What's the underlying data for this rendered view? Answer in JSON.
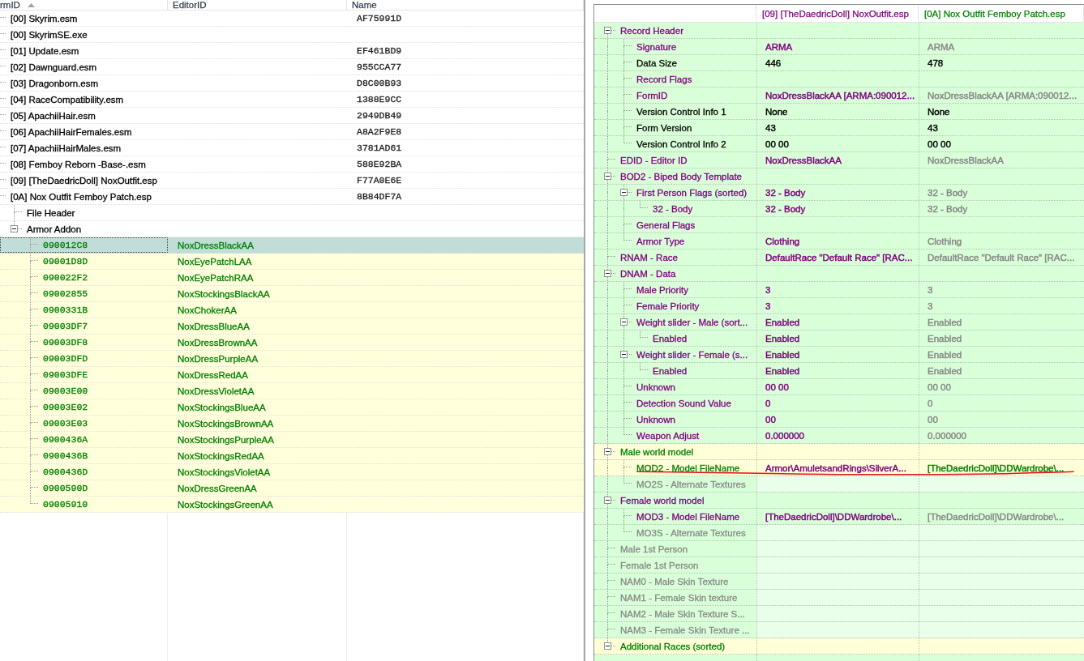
{
  "left_pane": {
    "columns": [
      {
        "label": "rmID",
        "sorted": true
      },
      {
        "label": "EditorID"
      },
      {
        "label": "Name"
      }
    ],
    "tree": [
      {
        "kind": "plugin",
        "label": "[00] Skyrim.esm",
        "name": "AF75991D",
        "selected": false,
        "highlighted": false
      },
      {
        "kind": "plugin",
        "label": "[00] SkyrimSE.exe",
        "selected": false,
        "highlighted": false
      },
      {
        "kind": "plugin",
        "label": "[01] Update.esm",
        "name": "EF461BD9",
        "selected": false,
        "highlighted": false
      },
      {
        "kind": "plugin",
        "label": "[02] Dawnguard.esm",
        "name": "955CCA77",
        "selected": false,
        "highlighted": false
      },
      {
        "kind": "plugin",
        "label": "[03] Dragonborn.esm",
        "name": "D8C00B93",
        "selected": false,
        "highlighted": false
      },
      {
        "kind": "plugin",
        "label": "[04] RaceCompatibility.esm",
        "name": "1388E9CC",
        "selected": false,
        "highlighted": false
      },
      {
        "kind": "plugin",
        "label": "[05] ApachiiHair.esm",
        "name": "2949DB49",
        "selected": false,
        "highlighted": false
      },
      {
        "kind": "plugin",
        "label": "[06] ApachiiHairFemales.esm",
        "name": "A8A2F9E8",
        "selected": false,
        "highlighted": false
      },
      {
        "kind": "plugin",
        "label": "[07] ApachiiHairMales.esm",
        "name": "3781AD61",
        "selected": false,
        "highlighted": false
      },
      {
        "kind": "plugin",
        "label": "[08] Femboy Reborn -Base-.esm",
        "name": "588E92BA",
        "selected": false,
        "highlighted": false
      },
      {
        "kind": "plugin",
        "label": "[09] [TheDaedricDoll] NoxOutfit.esp",
        "name": "F77A0E6E",
        "selected": false,
        "highlighted": false
      },
      {
        "kind": "plugin",
        "label": "[0A] Nox Outfit Femboy Patch.esp",
        "name": "8B84DF7A",
        "selected": false,
        "highlighted": false,
        "children": [
          {
            "kind": "group",
            "label": "File Header",
            "selected": false,
            "highlighted": false
          },
          {
            "kind": "group",
            "label": "Armor Addon",
            "selected": false,
            "highlighted": false,
            "expanded": true,
            "children": [
              {
                "kind": "record",
                "label": "090012C8",
                "editor_id": "NoxDressBlackAA",
                "color": "#008000",
                "selected": true
              },
              {
                "kind": "record",
                "label": "09001D8D",
                "editor_id": "NoxEyePatchLAA",
                "color": "#008000",
                "selected": false,
                "highlighted": true
              },
              {
                "kind": "record",
                "label": "090022F2",
                "editor_id": "NoxEyePatchRAA",
                "color": "#008000",
                "selected": false,
                "highlighted": true
              },
              {
                "kind": "record",
                "label": "09002855",
                "editor_id": "NoxStockingsBlackAA",
                "color": "#008000",
                "selected": false,
                "highlighted": true
              },
              {
                "kind": "record",
                "label": "0900331B",
                "editor_id": "NoxChokerAA",
                "color": "#008000",
                "selected": false,
                "highlighted": true
              },
              {
                "kind": "record",
                "label": "09003DF7",
                "editor_id": "NoxDressBlueAA",
                "color": "#008000",
                "selected": false,
                "highlighted": true
              },
              {
                "kind": "record",
                "label": "09003DF8",
                "editor_id": "NoxDressBrownAA",
                "color": "#008000",
                "selected": false,
                "highlighted": true
              },
              {
                "kind": "record",
                "label": "09003DFD",
                "editor_id": "NoxDressPurpleAA",
                "color": "#008000",
                "selected": false,
                "highlighted": true
              },
              {
                "kind": "record",
                "label": "09003DFE",
                "editor_id": "NoxDressRedAA",
                "color": "#008000",
                "selected": false,
                "highlighted": true
              },
              {
                "kind": "record",
                "label": "09003E00",
                "editor_id": "NoxDressVioletAA",
                "color": "#008000",
                "selected": false,
                "highlighted": true
              },
              {
                "kind": "record",
                "label": "09003E02",
                "editor_id": "NoxStockingsBlueAA",
                "color": "#008000",
                "selected": false,
                "highlighted": true
              },
              {
                "kind": "record",
                "label": "09003E03",
                "editor_id": "NoxStockingsBrownAA",
                "color": "#008000",
                "selected": false,
                "highlighted": true
              },
              {
                "kind": "record",
                "label": "0900436A",
                "editor_id": "NoxStockingsPurpleAA",
                "color": "#008000",
                "selected": false,
                "highlighted": true
              },
              {
                "kind": "record",
                "label": "0900436B",
                "editor_id": "NoxStockingsRedAA",
                "color": "#008000",
                "selected": false,
                "highlighted": true
              },
              {
                "kind": "record",
                "label": "0900436D",
                "editor_id": "NoxStockingsVioletAA",
                "color": "#008000",
                "selected": false,
                "highlighted": true
              },
              {
                "kind": "record",
                "label": "0900590D",
                "editor_id": "NoxDressGreenAA",
                "color": "#008000",
                "selected": false,
                "highlighted": true
              },
              {
                "kind": "record",
                "label": "09005910",
                "editor_id": "NoxStockingsGreenAA",
                "color": "#008000",
                "selected": false,
                "highlighted": true
              }
            ]
          }
        ]
      }
    ]
  },
  "right_pane": {
    "columns": [
      {
        "label": "[09] [TheDaedricDoll] NoxOutfit.esp",
        "color": "#800080"
      },
      {
        "label": "[0A] Nox Outfit Femboy Patch.esp",
        "color": "#008000"
      }
    ],
    "tree": [
      {
        "label": "Record Header",
        "color": "#800080",
        "highlighted": false,
        "faded": false,
        "expanded": true,
        "children": [
          {
            "label": "Signature",
            "color": "#800080",
            "highlighted": false,
            "faded": false,
            "values": [
              {
                "text": "ARMA",
                "color": "#800080"
              },
              {
                "text": "ARMA",
                "color": "#888888"
              }
            ]
          },
          {
            "label": "Data Size",
            "color": "#000000",
            "highlighted": false,
            "faded": false,
            "values": [
              {
                "text": "446",
                "color": "#000000"
              },
              {
                "text": "478",
                "color": "#000000"
              }
            ]
          },
          {
            "label": "Record Flags",
            "color": "#800080",
            "highlighted": false,
            "faded": false
          },
          {
            "label": "FormID",
            "color": "#800080",
            "highlighted": false,
            "faded": false,
            "values": [
              {
                "text": "NoxDressBlackAA [ARMA:090012...",
                "color": "#800080"
              },
              {
                "text": "NoxDressBlackAA [ARMA:090012...",
                "color": "#888888"
              }
            ]
          },
          {
            "label": "Version Control Info 1",
            "color": "#000000",
            "highlighted": false,
            "faded": false,
            "values": [
              {
                "text": "None",
                "color": "#000000"
              },
              {
                "text": "None",
                "color": "#000000"
              }
            ]
          },
          {
            "label": "Form Version",
            "color": "#000000",
            "highlighted": false,
            "faded": false,
            "values": [
              {
                "text": "43",
                "color": "#000000"
              },
              {
                "text": "43",
                "color": "#000000"
              }
            ]
          },
          {
            "label": "Version Control Info 2",
            "color": "#000000",
            "highlighted": false,
            "faded": false,
            "values": [
              {
                "text": "00 00",
                "color": "#000000"
              },
              {
                "text": "00 00",
                "color": "#000000"
              }
            ]
          }
        ]
      },
      {
        "label": "EDID - Editor ID",
        "color": "#800080",
        "highlighted": false,
        "faded": false,
        "values": [
          {
            "text": "NoxDressBlackAA",
            "color": "#800080"
          },
          {
            "text": "NoxDressBlackAA",
            "color": "#888888"
          }
        ]
      },
      {
        "label": "BOD2 - Biped Body Template",
        "color": "#800080",
        "highlighted": false,
        "faded": false,
        "expanded": true,
        "children": [
          {
            "label": "First Person Flags (sorted)",
            "color": "#800080",
            "highlighted": false,
            "faded": false,
            "expanded": true,
            "values": [
              {
                "text": "32 - Body",
                "color": "#800080"
              },
              {
                "text": "32 - Body",
                "color": "#888888"
              }
            ],
            "children": [
              {
                "label": "32 - Body",
                "color": "#800080",
                "highlighted": false,
                "faded": false,
                "values": [
                  {
                    "text": "32 - Body",
                    "color": "#800080"
                  },
                  {
                    "text": "32 - Body",
                    "color": "#888888"
                  }
                ]
              }
            ]
          },
          {
            "label": "General Flags",
            "color": "#800080",
            "highlighted": false,
            "faded": false
          },
          {
            "label": "Armor Type",
            "color": "#800080",
            "highlighted": false,
            "faded": false,
            "values": [
              {
                "text": "Clothing",
                "color": "#800080"
              },
              {
                "text": "Clothing",
                "color": "#888888"
              }
            ]
          }
        ]
      },
      {
        "label": "RNAM - Race",
        "color": "#800080",
        "highlighted": false,
        "faded": false,
        "values": [
          {
            "text": "DefaultRace \"Default Race\" [RAC...",
            "color": "#800080"
          },
          {
            "text": "DefaultRace \"Default Race\" [RAC...",
            "color": "#888888"
          }
        ]
      },
      {
        "label": "DNAM - Data",
        "color": "#800080",
        "highlighted": false,
        "faded": false,
        "expanded": true,
        "children": [
          {
            "label": "Male Priority",
            "color": "#800080",
            "highlighted": false,
            "faded": false,
            "values": [
              {
                "text": "3",
                "color": "#800080"
              },
              {
                "text": "3",
                "color": "#888888"
              }
            ]
          },
          {
            "label": "Female Priority",
            "color": "#800080",
            "highlighted": false,
            "faded": false,
            "values": [
              {
                "text": "3",
                "color": "#800080"
              },
              {
                "text": "3",
                "color": "#888888"
              }
            ]
          },
          {
            "label": "Weight slider - Male (sort...",
            "color": "#800080",
            "highlighted": false,
            "faded": false,
            "expanded": true,
            "values": [
              {
                "text": "Enabled",
                "color": "#800080"
              },
              {
                "text": "Enabled",
                "color": "#888888"
              }
            ],
            "children": [
              {
                "label": "Enabled",
                "color": "#800080",
                "highlighted": false,
                "faded": false,
                "values": [
                  {
                    "text": "Enabled",
                    "color": "#800080"
                  },
                  {
                    "text": "Enabled",
                    "color": "#888888"
                  }
                ]
              }
            ]
          },
          {
            "label": "Weight slider - Female (s...",
            "color": "#800080",
            "highlighted": false,
            "faded": false,
            "expanded": true,
            "values": [
              {
                "text": "Enabled",
                "color": "#800080"
              },
              {
                "text": "Enabled",
                "color": "#888888"
              }
            ],
            "children": [
              {
                "label": "Enabled",
                "color": "#800080",
                "highlighted": false,
                "faded": false,
                "values": [
                  {
                    "text": "Enabled",
                    "color": "#800080"
                  },
                  {
                    "text": "Enabled",
                    "color": "#888888"
                  }
                ]
              }
            ]
          },
          {
            "label": "Unknown",
            "color": "#800080",
            "highlighted": false,
            "faded": false,
            "values": [
              {
                "text": "00 00",
                "color": "#800080"
              },
              {
                "text": "00 00",
                "color": "#888888"
              }
            ]
          },
          {
            "label": "Detection Sound Value",
            "color": "#800080",
            "highlighted": false,
            "faded": false,
            "values": [
              {
                "text": "0",
                "color": "#800080"
              },
              {
                "text": "0",
                "color": "#888888"
              }
            ]
          },
          {
            "label": "Unknown",
            "color": "#800080",
            "highlighted": false,
            "faded": false,
            "values": [
              {
                "text": "00",
                "color": "#800080"
              },
              {
                "text": "00",
                "color": "#888888"
              }
            ]
          },
          {
            "label": "Weapon Adjust",
            "color": "#800080",
            "highlighted": false,
            "faded": false,
            "values": [
              {
                "text": "0.000000",
                "color": "#800080"
              },
              {
                "text": "0.000000",
                "color": "#888888"
              }
            ]
          }
        ]
      },
      {
        "label": "Male world model",
        "color": "#008000",
        "highlighted": true,
        "faded": false,
        "expanded": true,
        "children": [
          {
            "label": "MOD2 - Model FileName",
            "color": "#008000",
            "highlighted": true,
            "faded": false,
            "underlined": true,
            "values": [
              {
                "text": "Armor\\AmuletsandRings\\SilverA...",
                "color": "#800080"
              },
              {
                "text": "[TheDaedricDoll]\\DDWardrobe\\...",
                "color": "#008000"
              }
            ]
          },
          {
            "label": "MO2S - Alternate Textures",
            "color": "#888888",
            "highlighted": false,
            "faded": true
          }
        ]
      },
      {
        "label": "Female world model",
        "color": "#800080",
        "highlighted": false,
        "faded": false,
        "expanded": true,
        "children": [
          {
            "label": "MOD3 - Model FileName",
            "color": "#800080",
            "highlighted": false,
            "faded": false,
            "values": [
              {
                "text": "[TheDaedricDoll]\\DDWardrobe\\...",
                "color": "#800080"
              },
              {
                "text": "[TheDaedricDoll]\\DDWardrobe\\...",
                "color": "#888888"
              }
            ]
          },
          {
            "label": "MO3S - Alternate Textures",
            "color": "#888888",
            "highlighted": false,
            "faded": true
          }
        ]
      },
      {
        "label": "Male 1st Person",
        "color": "#888888",
        "highlighted": false,
        "faded": true
      },
      {
        "label": "Female 1st Person",
        "color": "#888888",
        "highlighted": false,
        "faded": true
      },
      {
        "label": "NAM0 - Male Skin Texture",
        "color": "#888888",
        "highlighted": false,
        "faded": true
      },
      {
        "label": "NAM1 - Female Skin texture",
        "color": "#888888",
        "highlighted": false,
        "faded": true
      },
      {
        "label": "NAM2 - Male Skin Texture S...",
        "color": "#888888",
        "highlighted": false,
        "faded": true
      },
      {
        "label": "NAM3 - Female Skin Texture ...",
        "color": "#888888",
        "highlighted": false,
        "faded": true
      },
      {
        "label": "Additional Races (sorted)",
        "color": "#008000",
        "highlighted": true,
        "faded": false,
        "expanded": true
      }
    ]
  }
}
